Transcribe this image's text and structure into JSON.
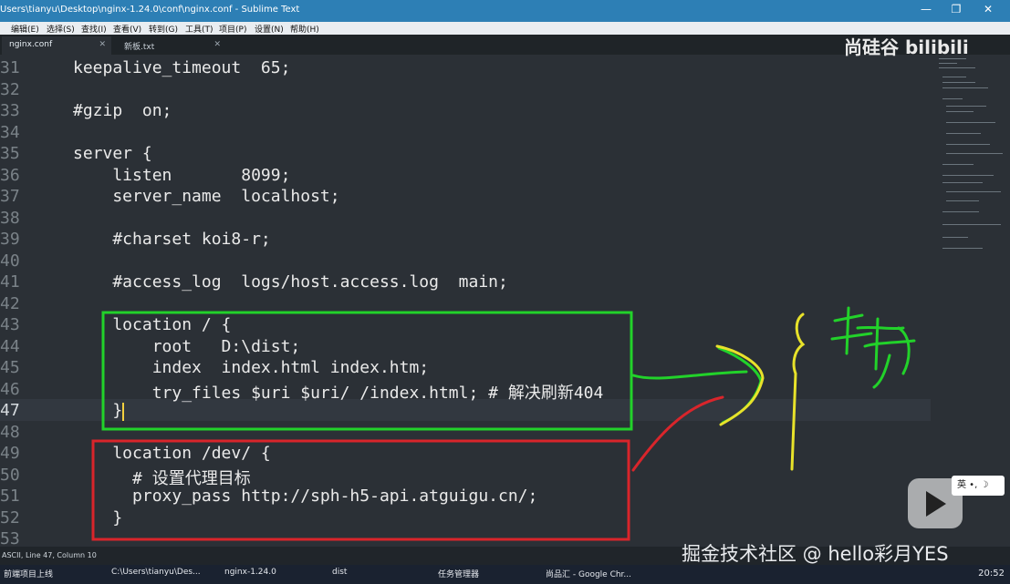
{
  "window": {
    "title": "Users\\tianyu\\Desktop\\nginx-1.24.0\\conf\\nginx.conf - Sublime Text",
    "controls": [
      "—",
      "❐",
      "✕"
    ]
  },
  "menu": [
    "编辑(E)",
    "选择(S)",
    "查找(I)",
    "查看(V)",
    "转到(G)",
    "工具(T)",
    "项目(P)",
    "设置(N)",
    "帮助(H)"
  ],
  "tabs": [
    {
      "label": "nginx.conf",
      "active": true
    },
    {
      "label": "新板.txt",
      "active": false
    }
  ],
  "editor": {
    "lines": [
      {
        "n": "31",
        "code": "keepalive_timeout  65;"
      },
      {
        "n": "32",
        "code": ""
      },
      {
        "n": "33",
        "code": "#gzip  on;"
      },
      {
        "n": "34",
        "code": ""
      },
      {
        "n": "35",
        "code": "server {"
      },
      {
        "n": "36",
        "code": "    listen       8099;"
      },
      {
        "n": "37",
        "code": "    server_name  localhost;"
      },
      {
        "n": "38",
        "code": ""
      },
      {
        "n": "39",
        "code": "    #charset koi8-r;"
      },
      {
        "n": "40",
        "code": ""
      },
      {
        "n": "41",
        "code": "    #access_log  logs/host.access.log  main;"
      },
      {
        "n": "42",
        "code": ""
      },
      {
        "n": "43",
        "code": "    location / {"
      },
      {
        "n": "44",
        "code": "        root   D:\\dist;"
      },
      {
        "n": "45",
        "code": "        index  index.html index.htm;"
      },
      {
        "n": "46",
        "code": "        try_files $uri $uri/ /index.html; # 解决刷新404"
      },
      {
        "n": "47",
        "code": "    }"
      },
      {
        "n": "48",
        "code": ""
      },
      {
        "n": "49",
        "code": "    location /dev/ {"
      },
      {
        "n": "50",
        "code": "      # 设置代理目标"
      },
      {
        "n": "51",
        "code": "      proxy_pass http://sph-h5-api.atguigu.cn/;"
      },
      {
        "n": "52",
        "code": "    }"
      },
      {
        "n": "53",
        "code": ""
      }
    ],
    "current_line": "47"
  },
  "status": {
    "text": "ASCII, Line 47, Column 10"
  },
  "taskbar": {
    "items": [
      "前端项目上线",
      "C:\\Users\\tianyu\\Des...",
      "nginx-1.24.0",
      "dist",
      "任务管理器",
      "尚品汇 - Google Chr..."
    ],
    "clock": "20:52"
  },
  "overlay": {
    "logo": "尚硅谷 bilibili",
    "watermark": "掘金技术社区 @ hello彩月YES",
    "ime": "英 •, ☽"
  },
  "colors": {
    "green_box": "#22d22a",
    "red_box": "#d9252b",
    "yellow": "#e8e22a",
    "titlebar": "#2d7fb5"
  }
}
